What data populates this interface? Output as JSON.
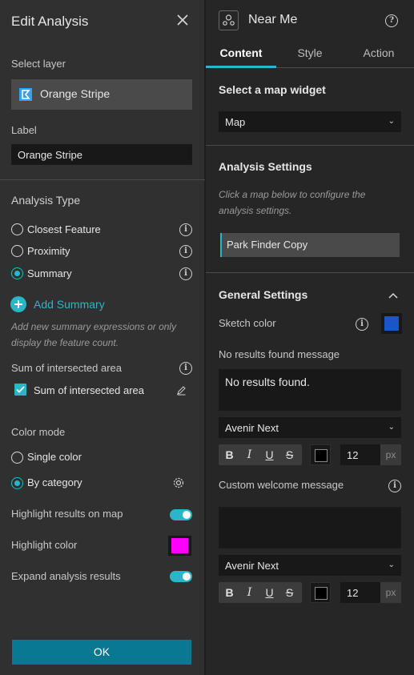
{
  "left_panel": {
    "title": "Edit Analysis",
    "select_layer_label": "Select layer",
    "layer_name": "Orange Stripe",
    "label_heading": "Label",
    "label_value": "Orange Stripe",
    "analysis_type_heading": "Analysis Type",
    "analysis_types": [
      {
        "label": "Closest Feature",
        "selected": false
      },
      {
        "label": "Proximity",
        "selected": false
      },
      {
        "label": "Summary",
        "selected": true
      }
    ],
    "add_summary_label": "Add Summary",
    "add_summary_hint": "Add new summary expressions or only display the feature count.",
    "sum_heading": "Sum of intersected area",
    "sum_checkbox_label": "Sum of intersected area",
    "color_mode_heading": "Color mode",
    "color_modes": [
      {
        "label": "Single color",
        "selected": false
      },
      {
        "label": "By category",
        "selected": true
      }
    ],
    "highlight_results_label": "Highlight results on map",
    "highlight_color_label": "Highlight color",
    "highlight_color": "#ff00ff",
    "expand_results_label": "Expand analysis results",
    "ok_label": "OK"
  },
  "right_panel": {
    "widget_title": "Near Me",
    "tabs": [
      {
        "label": "Content",
        "active": true
      },
      {
        "label": "Style",
        "active": false
      },
      {
        "label": "Action",
        "active": false
      }
    ],
    "map_widget_heading": "Select a map widget",
    "map_widget_value": "Map",
    "analysis_settings_heading": "Analysis Settings",
    "analysis_settings_hint": "Click a map below to configure the analysis settings.",
    "analysis_item": "Park Finder Copy",
    "general_settings_heading": "General Settings",
    "sketch_color_label": "Sketch color",
    "sketch_color": "#1a56c8",
    "no_results_label": "No results found message",
    "no_results_value": "No results found.",
    "font_1": "Avenir Next",
    "font_size_1": "12",
    "unit": "px",
    "welcome_label": "Custom welcome message",
    "welcome_value": "",
    "font_2": "Avenir Next",
    "font_size_2": "12",
    "fmt_bold": "B",
    "fmt_italic": "I",
    "fmt_underline": "U",
    "fmt_strike": "S"
  },
  "colors": {
    "accent": "#2bb5c8",
    "ok_button": "#087990"
  }
}
